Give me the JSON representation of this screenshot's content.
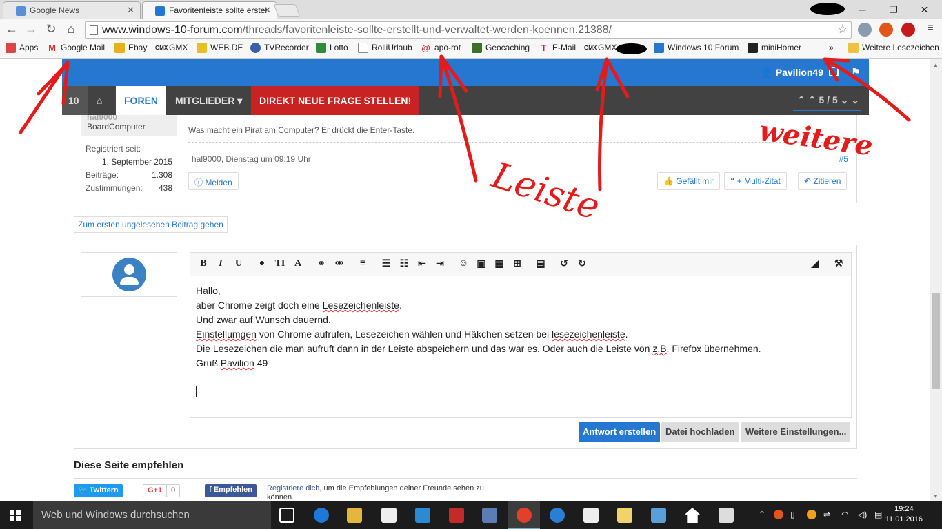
{
  "browser": {
    "tabs": [
      {
        "title": "Google News",
        "color": "#5a8fd8"
      },
      {
        "title": "Favoritenleiste sollte erstel",
        "color": "#2577cf"
      }
    ],
    "url_host": "www.windows-10-forum.com",
    "url_path": "/threads/favoritenleiste-sollte-erstellt-und-verwaltet-werden-koennen.21388/",
    "bookmarks": [
      {
        "label": "Apps",
        "icon": "apps-grid-icon"
      },
      {
        "label": "Google Mail",
        "icon": "gmail-icon"
      },
      {
        "label": "Ebay",
        "icon": "ebay-icon"
      },
      {
        "label": "GMX",
        "icon": "gmx-icon"
      },
      {
        "label": "WEB.DE",
        "icon": "webde-icon"
      },
      {
        "label": "TVRecorder",
        "icon": "tvrecorder-icon"
      },
      {
        "label": "Lotto",
        "icon": "lotto-icon"
      },
      {
        "label": "RolliUrlaub",
        "icon": "page-icon"
      },
      {
        "label": "apo-rot",
        "icon": "at-icon"
      },
      {
        "label": "Geocaching",
        "icon": "geocaching-icon"
      },
      {
        "label": "E-Mail",
        "icon": "telekom-icon"
      },
      {
        "label": "GMX",
        "icon": "gmx-icon"
      },
      {
        "label": "Windows 10 Forum",
        "icon": "forum-icon"
      },
      {
        "label": "miniHomer",
        "icon": "minihomer-icon"
      }
    ],
    "more_bookmarks_chevron": "»",
    "other_bookmarks": "Weitere Lesezeichen"
  },
  "forum": {
    "username": "Pavilion49",
    "nav": {
      "foren": "FOREN",
      "mitglieder": "MITGLIEDER ▾",
      "frage": "DIREKT NEUE FRAGE STELLEN!"
    },
    "pager": "5 / 5"
  },
  "post": {
    "author": "hal9000",
    "rank": "BoardComputer",
    "stats": [
      {
        "label": "Registriert seit:",
        "value": ""
      },
      {
        "label": "",
        "value": "1. September 2015"
      },
      {
        "label": "Beiträge:",
        "value": "1.308"
      },
      {
        "label": "Zustimmungen:",
        "value": "438"
      }
    ],
    "signature": "Was macht ein Pirat am Computer? Er drückt die Enter-Taste.",
    "meta": "hal9000, Dienstag um 09:19 Uhr",
    "number": "#5",
    "report": "Melden",
    "like": "Gefällt mir",
    "multiquote": "+ Multi-Zitat",
    "quote": "Zitieren"
  },
  "first_unread": "Zum ersten ungelesenen Beitrag gehen",
  "reply": {
    "lines": [
      [
        "Hallo,"
      ],
      [
        "aber Chrome zeigt doch eine ",
        "*Lesezeichenleiste",
        "."
      ],
      [
        "Und zwar auf Wunsch dauernd."
      ],
      [
        "*Einstellumgen",
        " von Chrome aufrufen, Lesezeichen wählen und Häkchen setzen bei ",
        "*lesezeichenleiste",
        "."
      ],
      [
        "Die Lesezeichen die man aufruft dann in der Leiste abspeichern und das war es. Oder auch die Leiste von ",
        "*z.B",
        ". Firefox übernehmen."
      ],
      [
        "Gruß ",
        "*Pavilion",
        " 49"
      ]
    ],
    "submit": "Antwort erstellen",
    "upload": "Datei hochladen",
    "more": "Weitere Einstellungen..."
  },
  "share": {
    "heading": "Diese Seite empfehlen",
    "twitter": "Twittern",
    "gplus": "G+1",
    "gplus_count": "0",
    "facebook": "Empfehlen",
    "fb_link": "Registriere dich,",
    "fb_text": " um die Empfehlungen deiner Freunde sehen zu können."
  },
  "taskbar": {
    "search_placeholder": "Web und Windows durchsuchen",
    "time": "19:24",
    "date": "11.01.2016"
  },
  "annotations": [
    "Leiste",
    "weitere"
  ],
  "colors": {
    "forum_blue": "#2577cf",
    "nav_dark": "#424242",
    "cta_red": "#c92222",
    "ink_red": "#e41b1b"
  }
}
